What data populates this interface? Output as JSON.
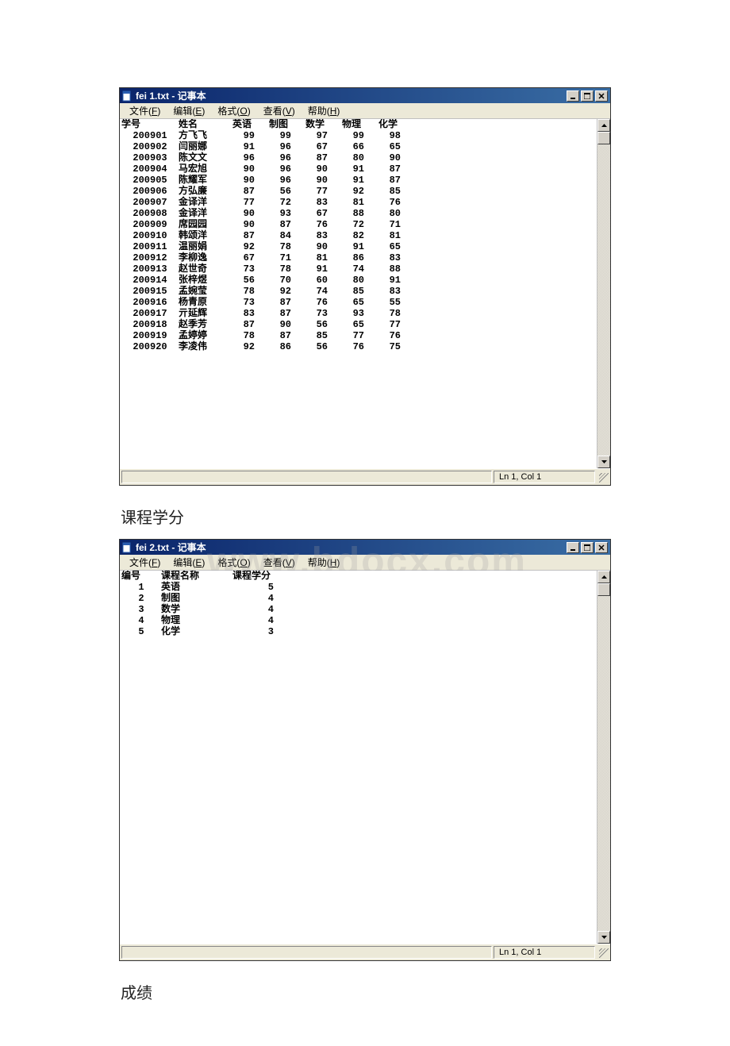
{
  "captions": {
    "credits": "课程学分",
    "grades": "成绩"
  },
  "win1": {
    "title": "fei 1.txt - 记事本",
    "status": "Ln 1, Col 1",
    "menu": [
      "文件(F)",
      "编辑(E)",
      "格式(O)",
      "查看(V)",
      "帮助(H)"
    ],
    "cols": {
      "c0": 72,
      "c1": 68,
      "c2": 46,
      "c3": 46,
      "c4": 46,
      "c5": 46,
      "c6": 46
    },
    "headers": [
      "学号",
      "姓名",
      "英语",
      "制图",
      "数学",
      "物理",
      "化学"
    ],
    "rows": [
      [
        "200901",
        "方飞飞",
        "99",
        "99",
        "97",
        "99",
        "98"
      ],
      [
        "200902",
        "闫丽娜",
        "91",
        "96",
        "67",
        "66",
        "65"
      ],
      [
        "200903",
        "陈文文",
        "96",
        "96",
        "87",
        "80",
        "90"
      ],
      [
        "200904",
        "马宏旭",
        "90",
        "96",
        "90",
        "91",
        "87"
      ],
      [
        "200905",
        "陈耀军",
        "90",
        "96",
        "90",
        "91",
        "87"
      ],
      [
        "200906",
        "方弘廉",
        "87",
        "56",
        "77",
        "92",
        "85"
      ],
      [
        "200907",
        "金译洋",
        "77",
        "72",
        "83",
        "81",
        "76"
      ],
      [
        "200908",
        "金译洋",
        "90",
        "93",
        "67",
        "88",
        "80"
      ],
      [
        "200909",
        "席园园",
        "90",
        "87",
        "76",
        "72",
        "71"
      ],
      [
        "200910",
        "韩颂洋",
        "87",
        "84",
        "83",
        "82",
        "81"
      ],
      [
        "200911",
        "温丽娟",
        "92",
        "78",
        "90",
        "91",
        "65"
      ],
      [
        "200912",
        "李柳逸",
        "67",
        "71",
        "81",
        "86",
        "83"
      ],
      [
        "200913",
        "赵世奇",
        "73",
        "78",
        "91",
        "74",
        "88"
      ],
      [
        "200914",
        "张梓煜",
        "56",
        "70",
        "60",
        "80",
        "91"
      ],
      [
        "200915",
        "孟婉莹",
        "78",
        "92",
        "74",
        "85",
        "83"
      ],
      [
        "200916",
        "杨青原",
        "73",
        "87",
        "76",
        "65",
        "55"
      ],
      [
        "200917",
        "亓延辉",
        "83",
        "87",
        "73",
        "93",
        "78"
      ],
      [
        "200918",
        "赵季芳",
        "87",
        "90",
        "56",
        "65",
        "77"
      ],
      [
        "200919",
        "孟婷婷",
        "78",
        "87",
        "85",
        "77",
        "76"
      ],
      [
        "200920",
        "李凌伟",
        "92",
        "86",
        "56",
        "76",
        "75"
      ]
    ],
    "clientHeight": 440
  },
  "win2": {
    "title": "fei 2.txt - 记事本",
    "status": "Ln 1, Col 1",
    "menu": [
      "文件(F)",
      "编辑(E)",
      "格式(O)",
      "查看(V)",
      "帮助(H)"
    ],
    "cols": {
      "c0": 50,
      "c1": 90,
      "c2": 70
    },
    "headers": [
      "编号",
      "课程名称",
      "课程学分"
    ],
    "rows": [
      [
        "1",
        "英语",
        "5"
      ],
      [
        "2",
        "制图",
        "4"
      ],
      [
        "3",
        "数学",
        "4"
      ],
      [
        "4",
        "物理",
        "4"
      ],
      [
        "5",
        "化学",
        "3"
      ]
    ],
    "clientHeight": 470
  },
  "watermark": "www.bdocx.com",
  "chart_data": [
    {
      "type": "table",
      "title": "学生成绩 (fei 1.txt)",
      "columns": [
        "学号",
        "姓名",
        "英语",
        "制图",
        "数学",
        "物理",
        "化学"
      ],
      "rows": [
        [
          "200901",
          "方飞飞",
          99,
          99,
          97,
          99,
          98
        ],
        [
          "200902",
          "闫丽娜",
          91,
          96,
          67,
          66,
          65
        ],
        [
          "200903",
          "陈文文",
          96,
          96,
          87,
          80,
          90
        ],
        [
          "200904",
          "马宏旭",
          90,
          96,
          90,
          91,
          87
        ],
        [
          "200905",
          "陈耀军",
          90,
          96,
          90,
          91,
          87
        ],
        [
          "200906",
          "方弘廉",
          87,
          56,
          77,
          92,
          85
        ],
        [
          "200907",
          "金译洋",
          77,
          72,
          83,
          81,
          76
        ],
        [
          "200908",
          "金译洋",
          90,
          93,
          67,
          88,
          80
        ],
        [
          "200909",
          "席园园",
          90,
          87,
          76,
          72,
          71
        ],
        [
          "200910",
          "韩颂洋",
          87,
          84,
          83,
          82,
          81
        ],
        [
          "200911",
          "温丽娟",
          92,
          78,
          90,
          91,
          65
        ],
        [
          "200912",
          "李柳逸",
          67,
          71,
          81,
          86,
          83
        ],
        [
          "200913",
          "赵世奇",
          73,
          78,
          91,
          74,
          88
        ],
        [
          "200914",
          "张梓煜",
          56,
          70,
          60,
          80,
          91
        ],
        [
          "200915",
          "孟婉莹",
          78,
          92,
          74,
          85,
          83
        ],
        [
          "200916",
          "杨青原",
          73,
          87,
          76,
          65,
          55
        ],
        [
          "200917",
          "亓延辉",
          83,
          87,
          73,
          93,
          78
        ],
        [
          "200918",
          "赵季芳",
          87,
          90,
          56,
          65,
          77
        ],
        [
          "200919",
          "孟婷婷",
          78,
          87,
          85,
          77,
          76
        ],
        [
          "200920",
          "李凌伟",
          92,
          86,
          56,
          76,
          75
        ]
      ]
    },
    {
      "type": "table",
      "title": "课程学分 (fei 2.txt)",
      "columns": [
        "编号",
        "课程名称",
        "课程学分"
      ],
      "rows": [
        [
          1,
          "英语",
          5
        ],
        [
          2,
          "制图",
          4
        ],
        [
          3,
          "数学",
          4
        ],
        [
          4,
          "物理",
          4
        ],
        [
          5,
          "化学",
          3
        ]
      ]
    }
  ]
}
